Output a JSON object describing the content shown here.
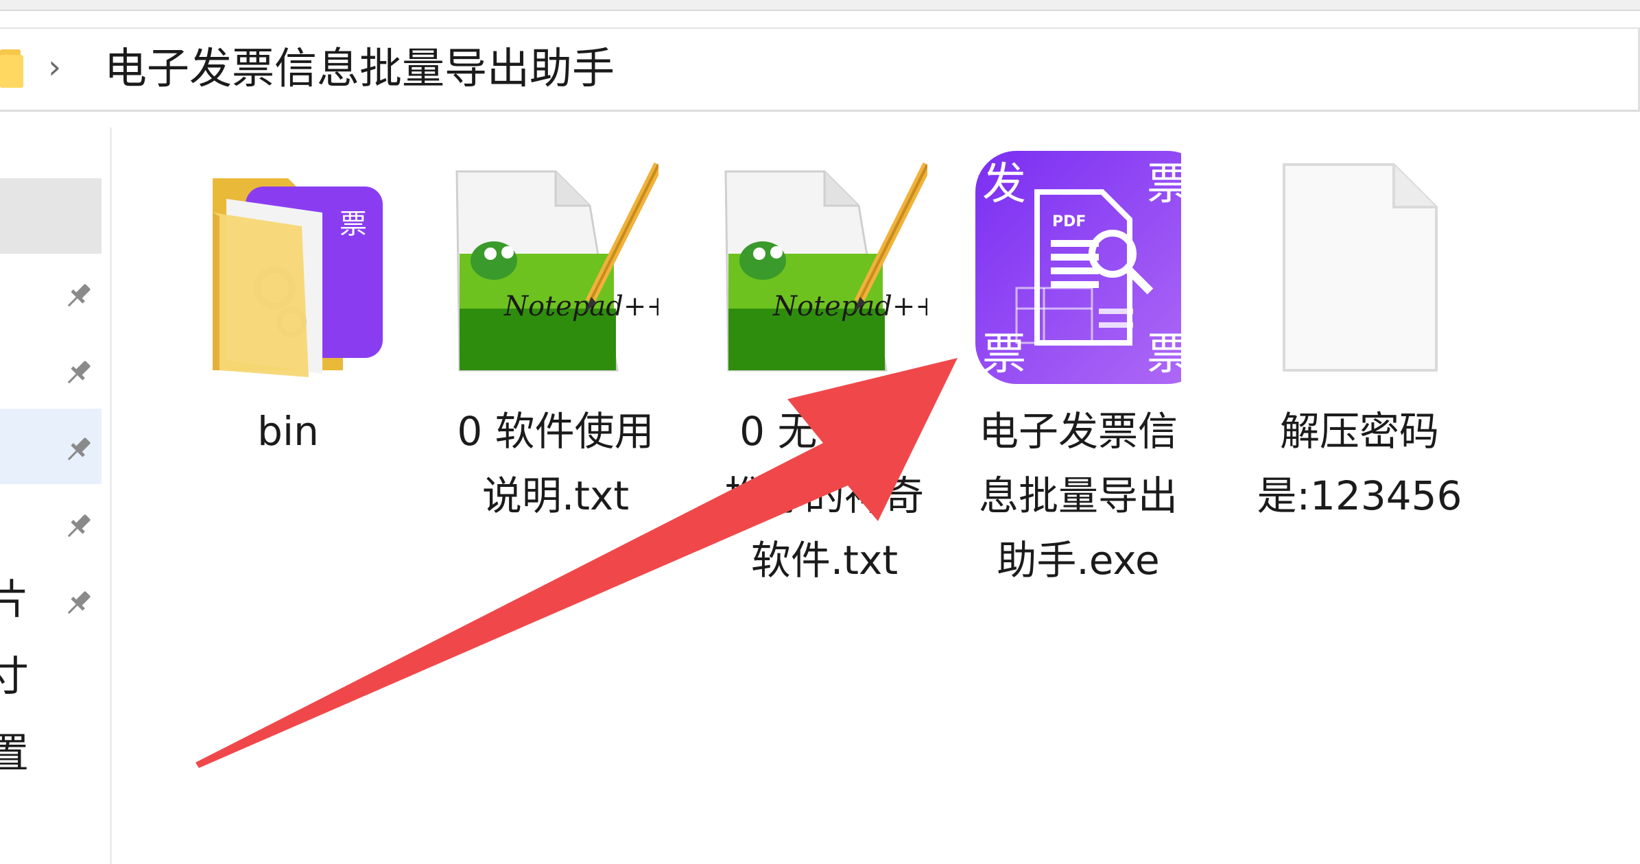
{
  "address_bar": {
    "path": "电子发票信息批量导出助手"
  },
  "nav_pane": {
    "partial_labels": [
      "片",
      "寸",
      "置"
    ]
  },
  "files": [
    {
      "name": "bin",
      "type": "folder-icon"
    },
    {
      "name": "0 软件使用说明.txt",
      "type": "notepadpp-document-icon"
    },
    {
      "name": "0 无              网管推荐的神奇软件.txt",
      "type": "notepadpp-document-icon"
    },
    {
      "name": "电子发票信息批量导出助手.exe",
      "type": "app-icon",
      "icon_chars": [
        "发",
        "票",
        "票",
        "票"
      ],
      "icon_text": "PDF"
    },
    {
      "name": "解压密码是:123456",
      "type": "blank-file-icon"
    }
  ],
  "colors": {
    "accent_purple": "#8a3df0",
    "arrow_red": "#f0484a",
    "folder_yellow": "#f5d36b"
  }
}
